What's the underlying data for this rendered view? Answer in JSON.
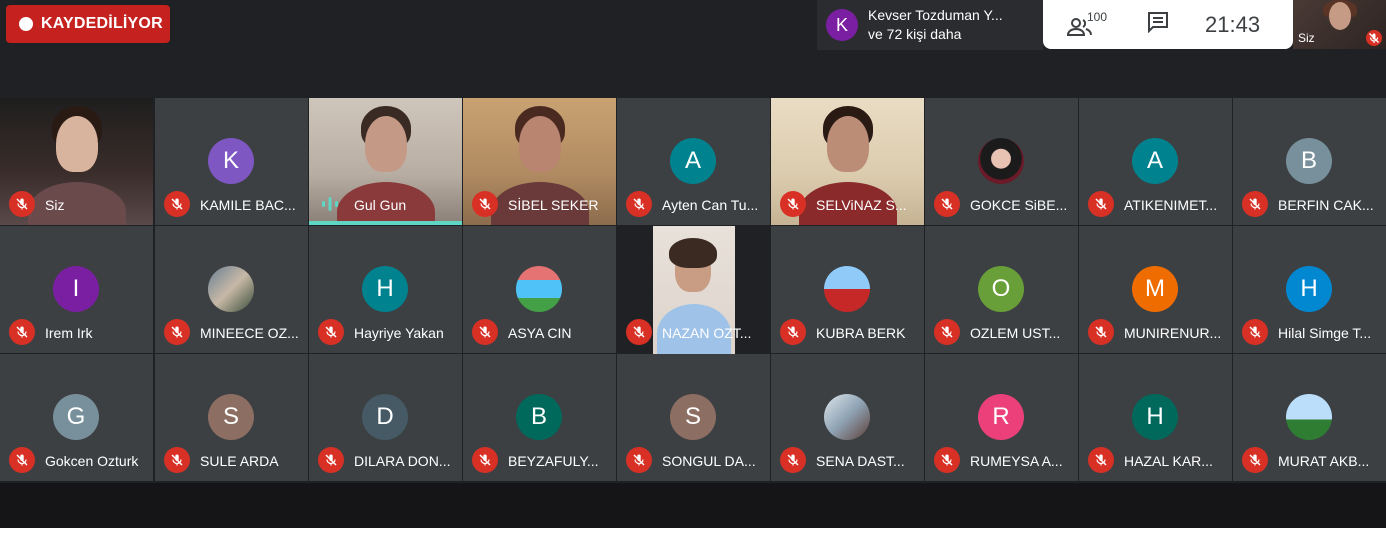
{
  "recording": {
    "label": "KAYDEDİLİYOR"
  },
  "presenter": {
    "initial": "K",
    "name": "Kevser Tozduman Y...",
    "more": "ve 72 kişi daha"
  },
  "topbar": {
    "people_count": "100",
    "clock": "21:43"
  },
  "self_view": {
    "label": "Siz"
  },
  "colors": {
    "muted": "#d93025",
    "speaking": "#5ed6c3",
    "recording": "#c5221f",
    "tile": "#3c4043"
  },
  "participants": [
    {
      "name": "Siz",
      "type": "video",
      "muted": true
    },
    {
      "name": "KAMILE BAC...",
      "type": "avatar",
      "initial": "K",
      "color": "#7e57c2",
      "muted": true
    },
    {
      "name": "Gul Gun",
      "type": "video",
      "speaking": true
    },
    {
      "name": "SİBEL SEKER",
      "type": "video",
      "muted": true
    },
    {
      "name": "Ayten Can Tu...",
      "type": "avatar",
      "initial": "A",
      "color": "#00838f",
      "muted": true
    },
    {
      "name": "SELViNAZ S...",
      "type": "video",
      "muted": true
    },
    {
      "name": "GOKCE SiBE...",
      "type": "photo",
      "muted": true
    },
    {
      "name": "ATIKENIMET...",
      "type": "avatar",
      "initial": "A",
      "color": "#00838f",
      "muted": true
    },
    {
      "name": "BERFIN CAK...",
      "type": "avatar",
      "initial": "B",
      "color": "#78909c",
      "muted": true
    },
    {
      "name": "Irem Irk",
      "type": "avatar",
      "initial": "I",
      "color": "#7b1fa2",
      "muted": true
    },
    {
      "name": "MINEECE OZ...",
      "type": "photo",
      "muted": true
    },
    {
      "name": "Hayriye Yakan",
      "type": "avatar",
      "initial": "H",
      "color": "#00838f",
      "muted": true
    },
    {
      "name": "ASYA CIN",
      "type": "photo",
      "muted": true
    },
    {
      "name": "NAZAN OZT...",
      "type": "video",
      "muted": true
    },
    {
      "name": "KUBRA BERK",
      "type": "photo",
      "muted": true
    },
    {
      "name": "OZLEM UST...",
      "type": "avatar",
      "initial": "O",
      "color": "#689f38",
      "muted": true
    },
    {
      "name": "MUNIRENUR...",
      "type": "avatar",
      "initial": "M",
      "color": "#ef6c00",
      "muted": true
    },
    {
      "name": "Hilal Simge T...",
      "type": "avatar",
      "initial": "H",
      "color": "#0288d1",
      "muted": true
    },
    {
      "name": "Gokcen Ozturk",
      "type": "avatar",
      "initial": "G",
      "color": "#78909c",
      "muted": true
    },
    {
      "name": "SULE ARDA",
      "type": "avatar",
      "initial": "S",
      "color": "#8d6e63",
      "muted": true
    },
    {
      "name": "DILARA DON...",
      "type": "avatar",
      "initial": "D",
      "color": "#455a64",
      "muted": true
    },
    {
      "name": "BEYZAFULY...",
      "type": "avatar",
      "initial": "B",
      "color": "#00695c",
      "muted": true
    },
    {
      "name": "SONGUL DA...",
      "type": "avatar",
      "initial": "S",
      "color": "#8d6e63",
      "muted": true
    },
    {
      "name": "SENA DAST...",
      "type": "photo",
      "muted": true
    },
    {
      "name": "RUMEYSA A...",
      "type": "avatar",
      "initial": "R",
      "color": "#ec407a",
      "muted": true
    },
    {
      "name": "HAZAL KAR...",
      "type": "avatar",
      "initial": "H",
      "color": "#00695c",
      "muted": true
    },
    {
      "name": "MURAT AKB...",
      "type": "photo",
      "muted": true
    }
  ]
}
